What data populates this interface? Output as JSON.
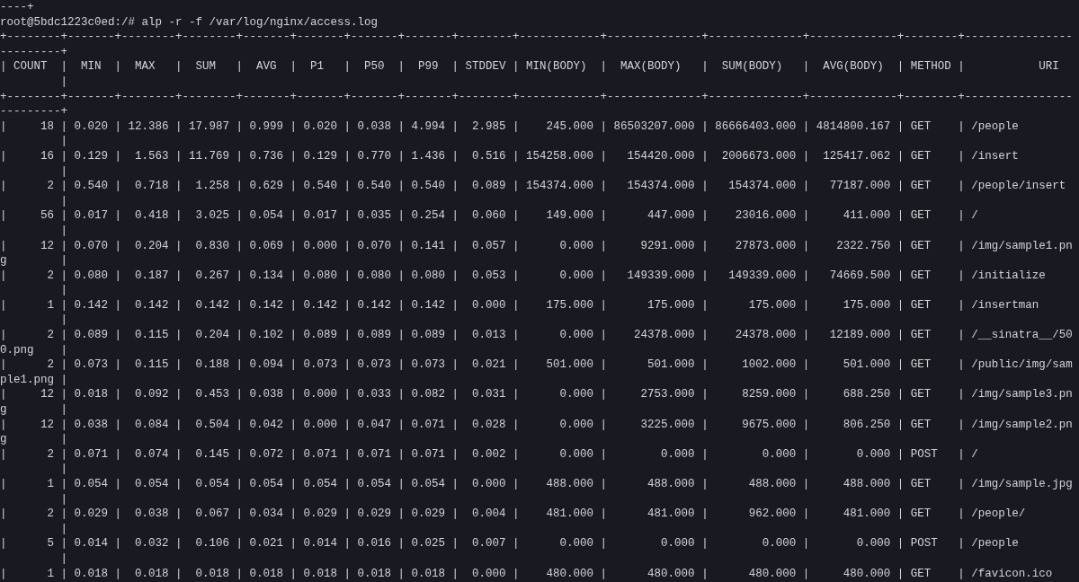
{
  "terminal": {
    "lines": [
      "----+",
      "root@5bdc1223c0ed:/# alp -r -f /var/log/nginx/access.log",
      "+--------+-------+--------+--------+-------+-------+-------+-------+--------+------------+--------------+--------------+-------------+--------+----------------",
      "---------+",
      "| COUNT  |  MIN  |  MAX   |  SUM   |  AVG  |  P1   |  P50  |  P99  | STDDEV | MIN(BODY)  |  MAX(BODY)   |  SUM(BODY)   |  AVG(BODY)  | METHOD |           URI",
      "         |",
      "+--------+-------+--------+--------+-------+-------+-------+-------+--------+------------+--------------+--------------+-------------+--------+----------------",
      "---------+",
      "|     18 | 0.020 | 12.386 | 17.987 | 0.999 | 0.020 | 0.038 | 4.994 |  2.985 |    245.000 | 86503207.000 | 86666403.000 | 4814800.167 | GET    | /people",
      "         |",
      "|     16 | 0.129 |  1.563 | 11.769 | 0.736 | 0.129 | 0.770 | 1.436 |  0.516 | 154258.000 |   154420.000 |  2006673.000 |  125417.062 | GET    | /insert",
      "         |",
      "|      2 | 0.540 |  0.718 |  1.258 | 0.629 | 0.540 | 0.540 | 0.540 |  0.089 | 154374.000 |   154374.000 |   154374.000 |   77187.000 | GET    | /people/insert",
      "         |",
      "|     56 | 0.017 |  0.418 |  3.025 | 0.054 | 0.017 | 0.035 | 0.254 |  0.060 |    149.000 |      447.000 |    23016.000 |     411.000 | GET    | /",
      "         |",
      "|     12 | 0.070 |  0.204 |  0.830 | 0.069 | 0.000 | 0.070 | 0.141 |  0.057 |      0.000 |     9291.000 |    27873.000 |    2322.750 | GET    | /img/sample1.pn",
      "g        |",
      "|      2 | 0.080 |  0.187 |  0.267 | 0.134 | 0.080 | 0.080 | 0.080 |  0.053 |      0.000 |   149339.000 |   149339.000 |   74669.500 | GET    | /initialize",
      "         |",
      "|      1 | 0.142 |  0.142 |  0.142 | 0.142 | 0.142 | 0.142 | 0.142 |  0.000 |    175.000 |      175.000 |      175.000 |     175.000 | GET    | /insertman",
      "         |",
      "|      2 | 0.089 |  0.115 |  0.204 | 0.102 | 0.089 | 0.089 | 0.089 |  0.013 |      0.000 |    24378.000 |    24378.000 |   12189.000 | GET    | /__sinatra__/50",
      "0.png    |",
      "|      2 | 0.073 |  0.115 |  0.188 | 0.094 | 0.073 | 0.073 | 0.073 |  0.021 |    501.000 |      501.000 |     1002.000 |     501.000 | GET    | /public/img/sam",
      "ple1.png |",
      "|     12 | 0.018 |  0.092 |  0.453 | 0.038 | 0.000 | 0.033 | 0.082 |  0.031 |      0.000 |     2753.000 |     8259.000 |     688.250 | GET    | /img/sample3.pn",
      "g        |",
      "|     12 | 0.038 |  0.084 |  0.504 | 0.042 | 0.000 | 0.047 | 0.071 |  0.028 |      0.000 |     3225.000 |     9675.000 |     806.250 | GET    | /img/sample2.pn",
      "g        |",
      "|      2 | 0.071 |  0.074 |  0.145 | 0.072 | 0.071 | 0.071 | 0.071 |  0.002 |      0.000 |        0.000 |        0.000 |       0.000 | POST   | /",
      "         |",
      "|      1 | 0.054 |  0.054 |  0.054 | 0.054 | 0.054 | 0.054 | 0.054 |  0.000 |    488.000 |      488.000 |      488.000 |     488.000 | GET    | /img/sample.jpg",
      "         |",
      "|      2 | 0.029 |  0.038 |  0.067 | 0.034 | 0.029 | 0.029 | 0.029 |  0.004 |    481.000 |      481.000 |      962.000 |     481.000 | GET    | /people/",
      "         |",
      "|      5 | 0.014 |  0.032 |  0.106 | 0.021 | 0.014 | 0.016 | 0.025 |  0.007 |      0.000 |        0.000 |        0.000 |       0.000 | POST   | /people",
      "         |",
      "|      1 | 0.018 |  0.018 |  0.018 | 0.018 | 0.018 | 0.018 | 0.018 |  0.000 |    480.000 |      480.000 |      480.000 |     480.000 | GET    | /favicon.ico"
    ]
  }
}
